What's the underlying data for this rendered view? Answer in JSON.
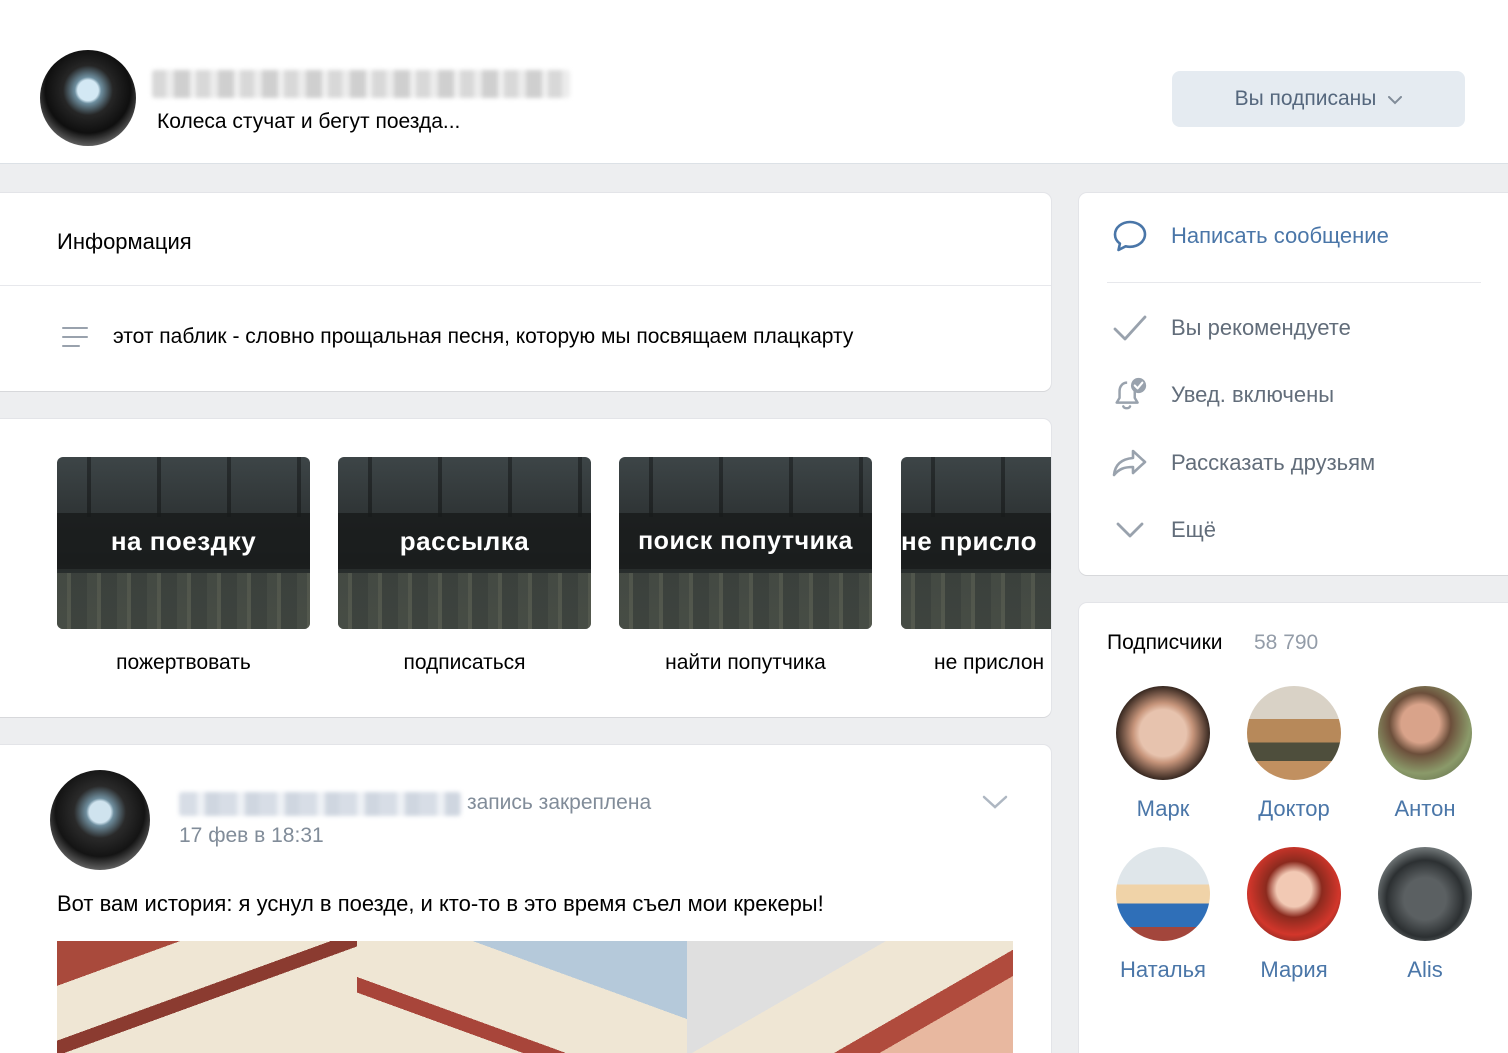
{
  "header": {
    "status": "Колеса стучат и бегут поезда...",
    "subscribe_button": "Вы подписаны"
  },
  "info": {
    "title": "Информация",
    "description": "этот паблик - словно прощальная песня, которую мы посвящаем плацкарту"
  },
  "links": [
    {
      "thumb_text": "на поездку",
      "label": "пожертвовать"
    },
    {
      "thumb_text": "рассылка",
      "label": "подписаться"
    },
    {
      "thumb_text": "поиск попутчика",
      "label": "найти попутчика"
    },
    {
      "thumb_text": "не присло",
      "label": "не прислон"
    }
  ],
  "post": {
    "pinned_label": "запись закреплена",
    "date": "17 фев в 18:31",
    "text": "Вот вам история: я уснул в поезде, и кто-то в это время съел мои крекеры!"
  },
  "actions": {
    "write_message": "Написать сообщение",
    "recommend": "Вы рекомендуете",
    "notifications": "Увед. включены",
    "share": "Рассказать друзьям",
    "more": "Ещё"
  },
  "subscribers": {
    "title": "Подписчики",
    "count": "58 790",
    "people": [
      {
        "name": "Марк"
      },
      {
        "name": "Доктор"
      },
      {
        "name": "Антон"
      },
      {
        "name": "Наталья"
      },
      {
        "name": "Мария"
      },
      {
        "name": "Alis"
      }
    ]
  },
  "colors": {
    "accent": "#4a76a8",
    "secondary_text": "#818c99",
    "background": "#edeef0"
  }
}
